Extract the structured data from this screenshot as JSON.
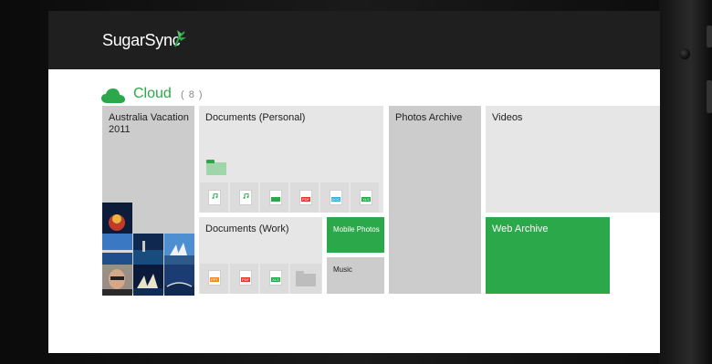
{
  "app": {
    "logo_text": "SugarSync",
    "brand_color": "#2aa84a"
  },
  "section": {
    "title": "Cloud",
    "count": "( 8 )"
  },
  "tiles": {
    "australia": {
      "label": "Australia Vacation 2011"
    },
    "docs_personal": {
      "label": "Documents (Personal)",
      "files": [
        "music",
        "music",
        "xls",
        "pdf",
        "doc",
        "xls"
      ]
    },
    "photos_archive": {
      "label": "Photos Archive"
    },
    "videos": {
      "label": "Videos"
    },
    "docs_work": {
      "label": "Documents (Work)",
      "files": [
        "ppt",
        "pdf",
        "xls"
      ]
    },
    "mobile_photos": {
      "label": "Mobile Photos"
    },
    "music": {
      "label": "Music"
    },
    "web_archive": {
      "label": "Web Archive"
    }
  },
  "file_badges": {
    "pdf": "PDF",
    "doc": "DOC",
    "xls": "XLS",
    "ppt": "PPT"
  }
}
